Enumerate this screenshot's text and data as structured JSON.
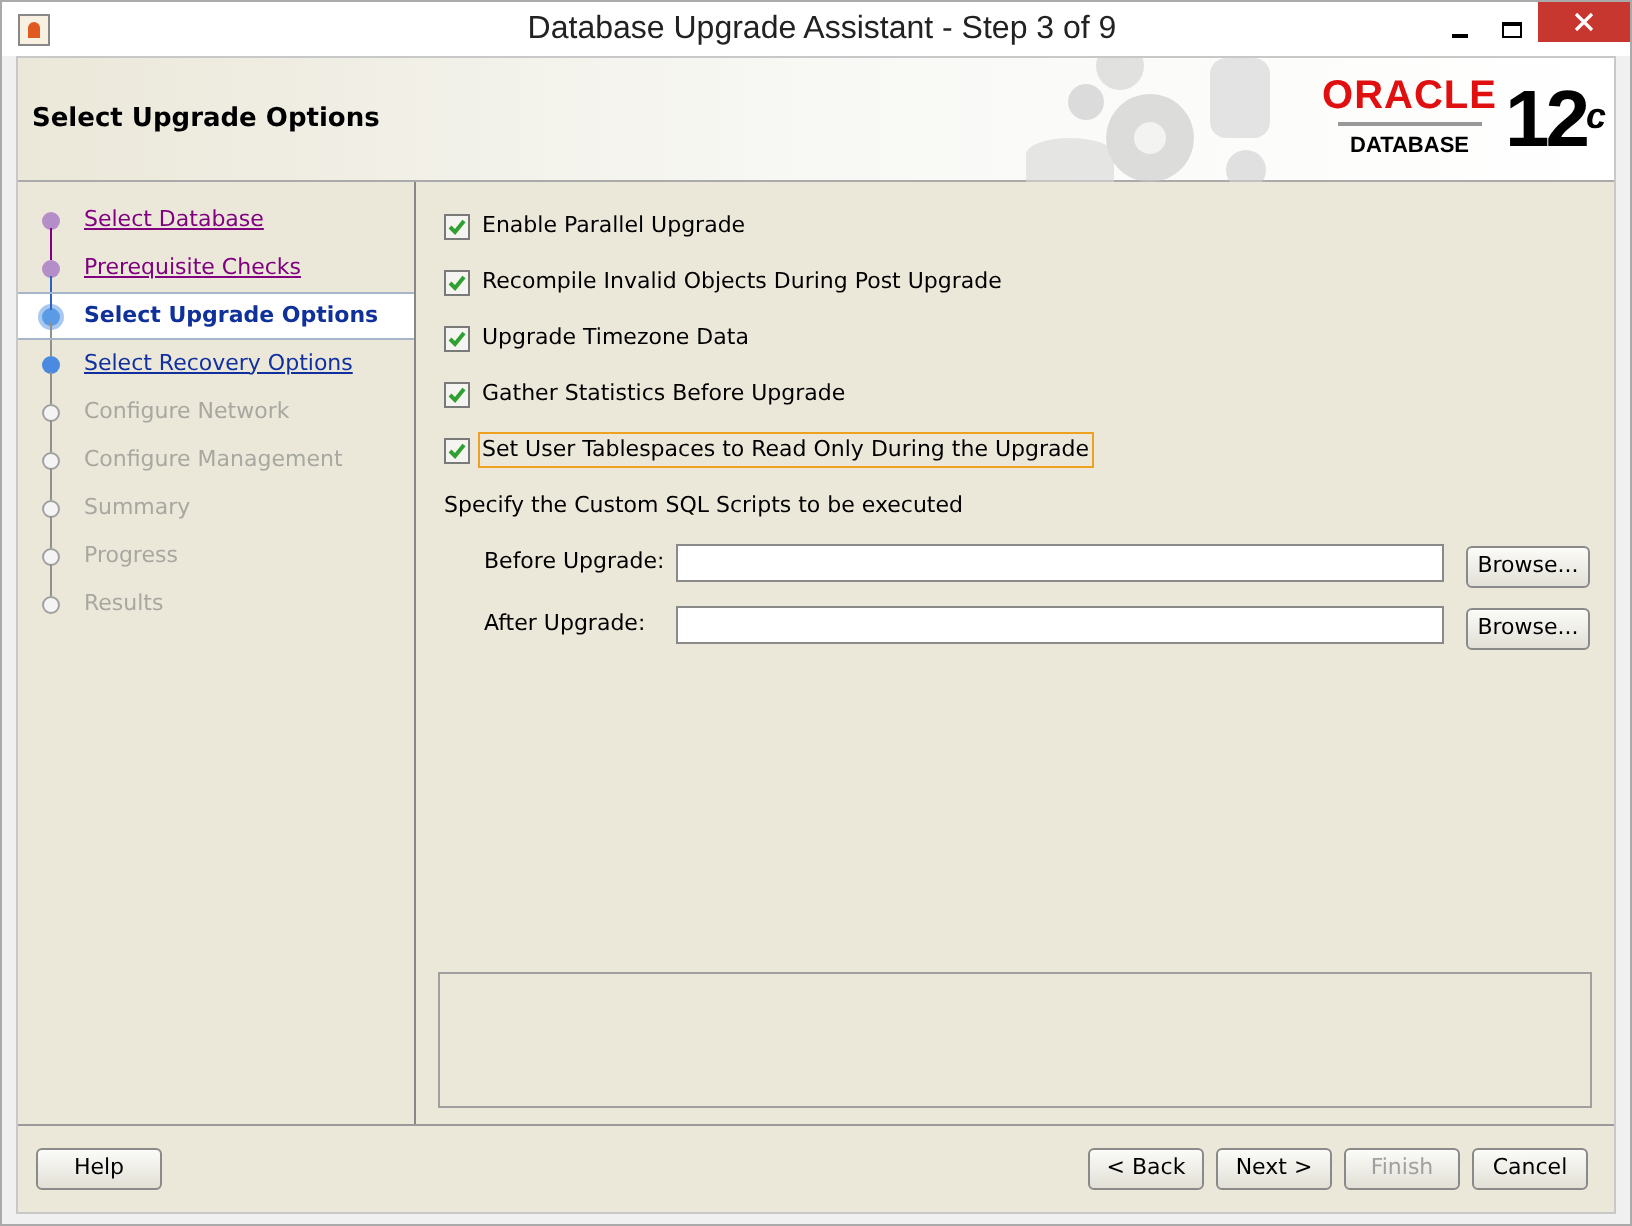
{
  "window": {
    "title": "Database Upgrade Assistant - Step 3 of 9"
  },
  "header": {
    "title": "Select Upgrade Options",
    "logo": {
      "brand": "ORACLE",
      "product": "DATABASE",
      "version": "12",
      "version_sup": "c"
    }
  },
  "steps": [
    {
      "label": "Select Database",
      "kind": "visited",
      "selected": false
    },
    {
      "label": "Prerequisite Checks",
      "kind": "visited",
      "selected": false
    },
    {
      "label": "Select Upgrade Options",
      "kind": "current",
      "selected": true
    },
    {
      "label": "Select Recovery Options",
      "kind": "available",
      "selected": false
    },
    {
      "label": "Configure Network",
      "kind": "disabled",
      "selected": false
    },
    {
      "label": "Configure Management",
      "kind": "disabled",
      "selected": false
    },
    {
      "label": "Summary",
      "kind": "disabled",
      "selected": false
    },
    {
      "label": "Progress",
      "kind": "disabled",
      "selected": false
    },
    {
      "label": "Results",
      "kind": "disabled",
      "selected": false
    }
  ],
  "options": [
    {
      "label": "Enable Parallel Upgrade",
      "checked": true,
      "focused": false
    },
    {
      "label": "Recompile Invalid Objects During Post Upgrade",
      "checked": true,
      "focused": false
    },
    {
      "label": "Upgrade Timezone Data",
      "checked": true,
      "focused": false
    },
    {
      "label": "Gather Statistics Before Upgrade",
      "checked": true,
      "focused": false
    },
    {
      "label": "Set User Tablespaces to Read Only During the Upgrade",
      "checked": true,
      "focused": true
    }
  ],
  "scripts": {
    "heading": "Specify the Custom SQL Scripts to be executed",
    "fields": [
      {
        "label": "Before Upgrade:",
        "button": "Browse..."
      },
      {
        "label": "After Upgrade:",
        "button": "Browse..."
      }
    ]
  },
  "buttons": {
    "help": "Help",
    "nav": [
      {
        "label": "< Back",
        "disabled": false
      },
      {
        "label": "Next >",
        "disabled": false
      },
      {
        "label": "Finish",
        "disabled": true
      },
      {
        "label": "Cancel",
        "disabled": false
      }
    ]
  }
}
